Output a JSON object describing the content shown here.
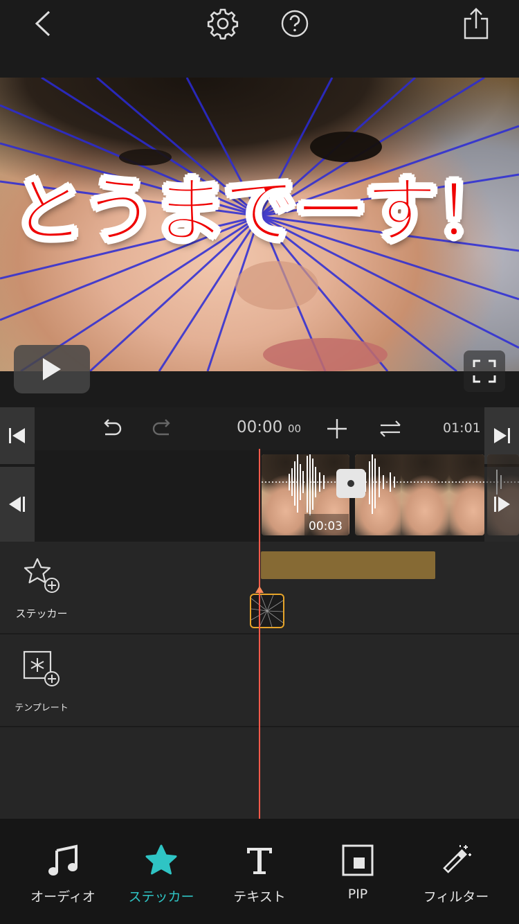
{
  "preview": {
    "caption": "とうまでーす！"
  },
  "timeline": {
    "current_time": "00:00",
    "current_frames": "00",
    "total_duration": "01:01",
    "clip_duration": "00:03"
  },
  "tracks": {
    "sticker_label": "ステッカー",
    "template_label": "テンプレート"
  },
  "tabs": [
    {
      "label": "オーディオ",
      "icon": "music-note-icon"
    },
    {
      "label": "ステッカー",
      "icon": "star-icon"
    },
    {
      "label": "テキスト",
      "icon": "text-icon"
    },
    {
      "label": "PIP",
      "icon": "pip-icon"
    },
    {
      "label": "フィルター",
      "icon": "magic-wand-icon"
    }
  ],
  "colors": {
    "accent": "#2fc4c4",
    "playhead": "#ff5a4a",
    "sticker_bar": "#866a34",
    "sticker_thumb_border": "#e6a42a",
    "caption_text": "#ef0000"
  }
}
